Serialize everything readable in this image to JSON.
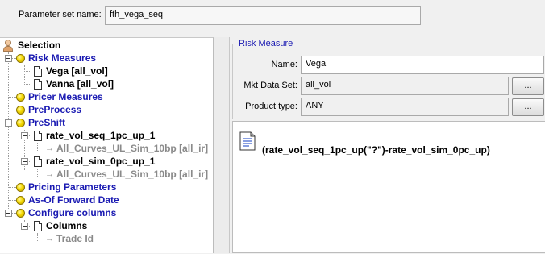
{
  "header": {
    "param_set_label": "Parameter set name:",
    "param_set_value": "fth_vega_seq"
  },
  "tree": {
    "root": "Selection",
    "risk_measures": "Risk Measures",
    "vega": "Vega [all_vol]",
    "vanna": "Vanna [all_vol]",
    "pricer_measures": "Pricer Measures",
    "preprocess": "PreProcess",
    "preshift": "PreShift",
    "rate_up": "rate_vol_seq_1pc_up_1",
    "all_curves_1": "All_Curves_UL_Sim_10bp [all_ir]",
    "rate_sim": "rate_vol_sim_0pc_up_1",
    "all_curves_2": "All_Curves_UL_Sim_10bp [all_ir]",
    "pricing_parameters": "Pricing Parameters",
    "asof_forward": "As-Of Forward Date",
    "configure_columns": "Configure columns",
    "columns": "Columns",
    "trade_id": "Trade Id"
  },
  "risk_measure": {
    "group_title": "Risk Measure",
    "name_label": "Name:",
    "name_value": "Vega",
    "mkt_label": "Mkt Data Set:",
    "mkt_value": "all_vol",
    "product_label": "Product type:",
    "product_value": "ANY",
    "dots_label": "..."
  },
  "expression": {
    "text": "(rate_vol_seq_1pc_up(\"?\")-rate_vol_sim_0pc_up)",
    "icon": "text-document-icon"
  }
}
